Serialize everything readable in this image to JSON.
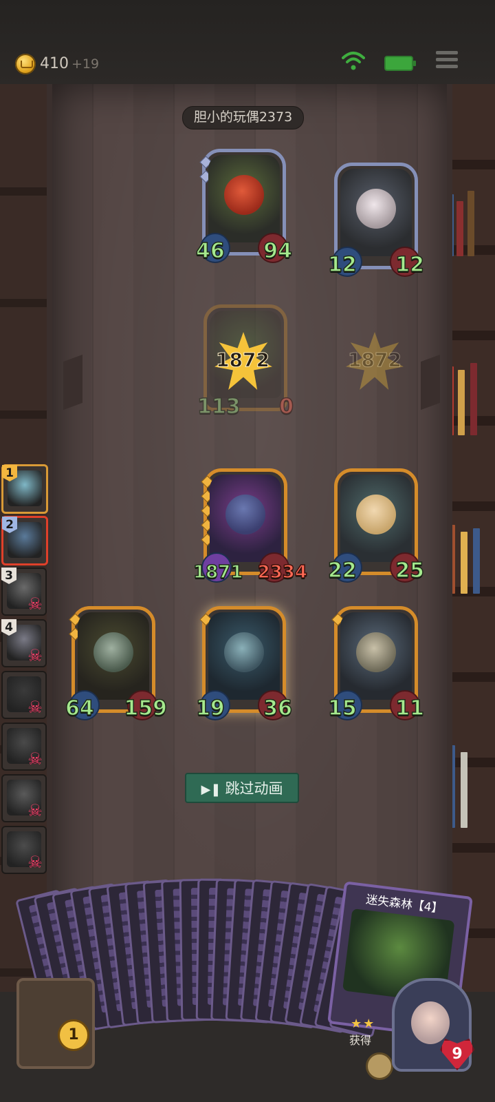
{
  "topbar": {
    "gold": "410",
    "gold_income": "+19",
    "icons": [
      "coin-icon",
      "wifi-icon",
      "battery-icon",
      "menu-icon"
    ]
  },
  "opponent": {
    "name": "胆小的玩偶2373"
  },
  "enemy_row": [
    {
      "name": "red-devil-minion",
      "attack": "46",
      "health": "94",
      "frame": "blue",
      "tier_marks": 2
    },
    {
      "name": "masked-rabbit-minion",
      "attack": "12",
      "health": "12",
      "frame": "blue",
      "tier_marks": 0
    }
  ],
  "combat": {
    "dying_minion": {
      "attack": "113",
      "health": "0"
    },
    "damage_dealt": "1872",
    "damage_ghost": "1872"
  },
  "player_row_top": [
    {
      "name": "mushroom-creature-minion",
      "attack": "1871",
      "health": "2334",
      "health_state": "damaged",
      "tier_marks": 5
    },
    {
      "name": "fairy-minion",
      "attack": "22",
      "health": "25",
      "tier_marks": 0
    }
  ],
  "player_row_bottom": [
    {
      "name": "witch-minion",
      "attack": "64",
      "health": "159",
      "tier_marks": 2
    },
    {
      "name": "elf-sorceress-minion",
      "attack": "19",
      "health": "36",
      "tier_marks": 1
    },
    {
      "name": "mushroom-spider-minion",
      "attack": "15",
      "health": "11",
      "tier_marks": 1
    }
  ],
  "roster": [
    {
      "rank": "1",
      "style": "first",
      "eliminated": false
    },
    {
      "rank": "2",
      "style": "active",
      "eliminated": false
    },
    {
      "rank": "3",
      "style": "normal",
      "eliminated": true
    },
    {
      "rank": "4",
      "style": "normal",
      "eliminated": true
    },
    {
      "rank": "",
      "style": "normal",
      "eliminated": true
    },
    {
      "rank": "",
      "style": "normal",
      "eliminated": true
    },
    {
      "rank": "",
      "style": "normal",
      "eliminated": true
    },
    {
      "rank": "",
      "style": "normal",
      "eliminated": true
    }
  ],
  "skip_button": {
    "label": "跳过动画"
  },
  "deck": {
    "featured_card_title": "迷失森林【4】",
    "featured_card_footer": "获得",
    "card_count_visible": 20
  },
  "bottom": {
    "chest_count": "1",
    "stars": "★★",
    "hero_health": "9"
  },
  "colors": {
    "stat_green": "#a5e98e",
    "stat_red": "#ff6a55",
    "frame_gold": "#d58c2a",
    "frame_blue": "#8590b8",
    "skip_button_bg": "#2f6a54"
  }
}
